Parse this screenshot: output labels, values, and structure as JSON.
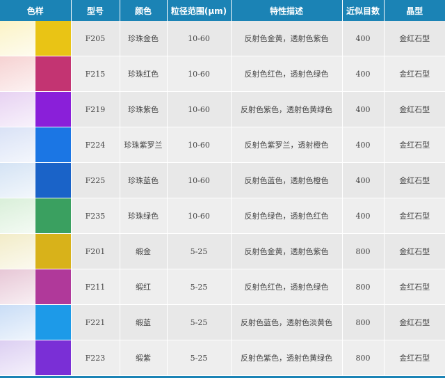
{
  "table": {
    "headers": [
      "色样",
      "型号",
      "颜色",
      "粒径范围(μm)",
      "特性描述",
      "近似目数",
      "晶型"
    ],
    "rows": [
      {
        "model": "F205",
        "color": "珍珠金色",
        "size": "10-60",
        "desc": "反射色金黄，透射色紫色",
        "mesh": "400",
        "crystal": "金红石型",
        "swatch": {
          "light": "#fbf3c6",
          "dark": "#e9c415"
        }
      },
      {
        "model": "F215",
        "color": "珍珠红色",
        "size": "10-60",
        "desc": "反射色红色，透射色绿色",
        "mesh": "400",
        "crystal": "金红石型",
        "swatch": {
          "light": "#f6d2d2",
          "dark": "#c33472"
        }
      },
      {
        "model": "F219",
        "color": "珍珠紫色",
        "size": "10-60",
        "desc": "反射色紫色，透射色黄绿色",
        "mesh": "400",
        "crystal": "金红石型",
        "swatch": {
          "light": "#e7d2f2",
          "dark": "#8a1fd9"
        }
      },
      {
        "model": "F224",
        "color": "珍珠紫罗兰",
        "size": "10-60",
        "desc": "反射色紫罗兰，透射橙色",
        "mesh": "400",
        "crystal": "金红石型",
        "swatch": {
          "light": "#d9e2f6",
          "dark": "#1b76e4"
        }
      },
      {
        "model": "F225",
        "color": "珍珠蓝色",
        "size": "10-60",
        "desc": "反射色蓝色，透射色橙色",
        "mesh": "400",
        "crystal": "金红石型",
        "swatch": {
          "light": "#d4e3f4",
          "dark": "#1a63c8"
        }
      },
      {
        "model": "F235",
        "color": "珍珠绿色",
        "size": "10-60",
        "desc": "反射色绿色，透射色红色",
        "mesh": "400",
        "crystal": "金红石型",
        "swatch": {
          "light": "#d9efd9",
          "dark": "#3aa060"
        }
      },
      {
        "model": "F201",
        "color": "缎金",
        "size": "5-25",
        "desc": "反射色金黄，透射色紫色",
        "mesh": "800",
        "crystal": "金红石型",
        "swatch": {
          "light": "#f2ecc8",
          "dark": "#d8b21a"
        }
      },
      {
        "model": "F211",
        "color": "缎红",
        "size": "5-25",
        "desc": "反射色红色，透射色绿色",
        "mesh": "800",
        "crystal": "金红石型",
        "swatch": {
          "light": "#e7c7d6",
          "dark": "#b0399a"
        }
      },
      {
        "model": "F221",
        "color": "缎蓝",
        "size": "5-25",
        "desc": "反射色蓝色，透射色淡黄色",
        "mesh": "800",
        "crystal": "金红石型",
        "swatch": {
          "light": "#c9ddf6",
          "dark": "#1d9ae8"
        }
      },
      {
        "model": "F223",
        "color": "缎紫",
        "size": "5-25",
        "desc": "反射色紫色，透射色黄绿色",
        "mesh": "800",
        "crystal": "金红石型",
        "swatch": {
          "light": "#dccff2",
          "dark": "#7a2fd6"
        }
      }
    ]
  },
  "colors": {
    "header_bg": "#1b83b5",
    "row_bg": "#eeeeee",
    "text": "#444444"
  }
}
